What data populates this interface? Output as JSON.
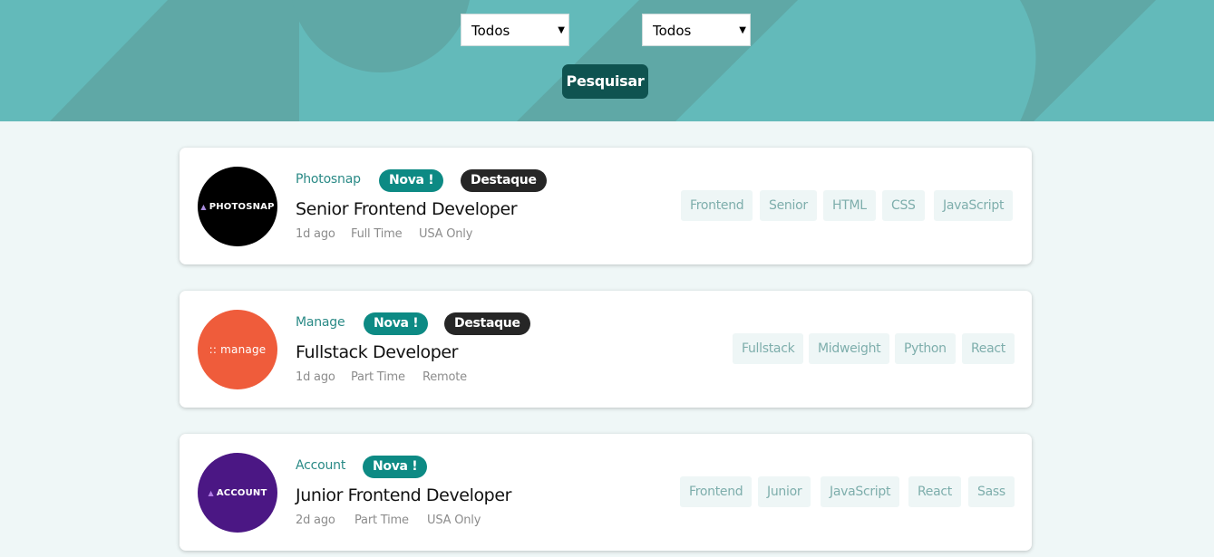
{
  "filters": {
    "first_select_value": "Todos",
    "second_select_value": "Todos",
    "search_label": "Pesquisar"
  },
  "colors": {
    "header_bg": "#63baba",
    "accent_dark": "#0f5350",
    "badge_new": "#0d8a84",
    "badge_featured": "#262626",
    "tag_text": "#7eaeac"
  },
  "jobs": [
    {
      "company": "Photosnap",
      "logo_text": "PHOTOSNAP",
      "logo_color": "#000000",
      "new_label": "Nova !",
      "featured_label": "Destaque",
      "position": "Senior Frontend Developer",
      "posted": "1d ago",
      "contract": "Full Time",
      "location": "USA Only",
      "tags": [
        "Frontend",
        "Senior",
        "HTML",
        "CSS",
        "JavaScript"
      ]
    },
    {
      "company": "Manage",
      "logo_text": ":: manage",
      "logo_color": "#ef5c3b",
      "new_label": "Nova !",
      "featured_label": "Destaque",
      "position": "Fullstack Developer",
      "posted": "1d ago",
      "contract": "Part Time",
      "location": "Remote",
      "tags": [
        "Fullstack",
        "Midweight",
        "Python",
        "React"
      ]
    },
    {
      "company": "Account",
      "logo_text": "ACCOUNT",
      "logo_color": "#4b1784",
      "new_label": "Nova !",
      "featured_label": "",
      "position": "Junior Frontend Developer",
      "posted": "2d ago",
      "contract": "Part Time",
      "location": "USA Only",
      "tags": [
        "Frontend",
        "Junior",
        "JavaScript",
        "React",
        "Sass"
      ]
    }
  ]
}
